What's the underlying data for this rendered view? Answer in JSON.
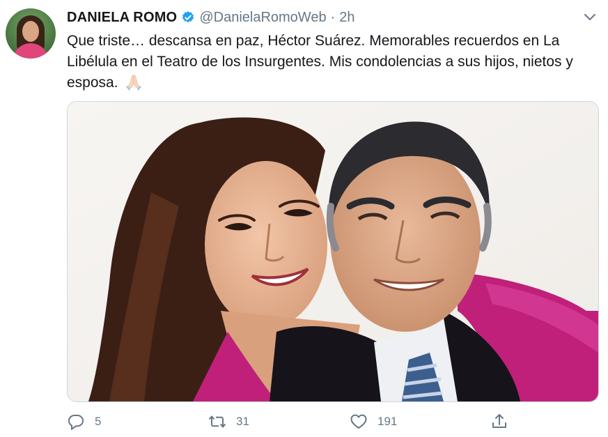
{
  "tweet": {
    "author_name": "DANIELA ROMO",
    "handle": "@DanielaRomoWeb",
    "separator": "·",
    "time": "2h",
    "text": "Que triste… descansa en paz, Héctor Suárez. Memorables recuerdos en La Libélula en el Teatro de los Insurgentes. Mis condolencias a sus hijos, nietos y esposa.",
    "emoji_icon": "folded-hands-emoji",
    "verified_icon": "verified-badge-icon",
    "verified_color": "#1da1f2"
  },
  "actions": {
    "reply_count": "5",
    "retweet_count": "31",
    "like_count": "191"
  },
  "colors": {
    "text": "#14171a",
    "secondary": "#657786",
    "border": "#ccd6dd"
  }
}
